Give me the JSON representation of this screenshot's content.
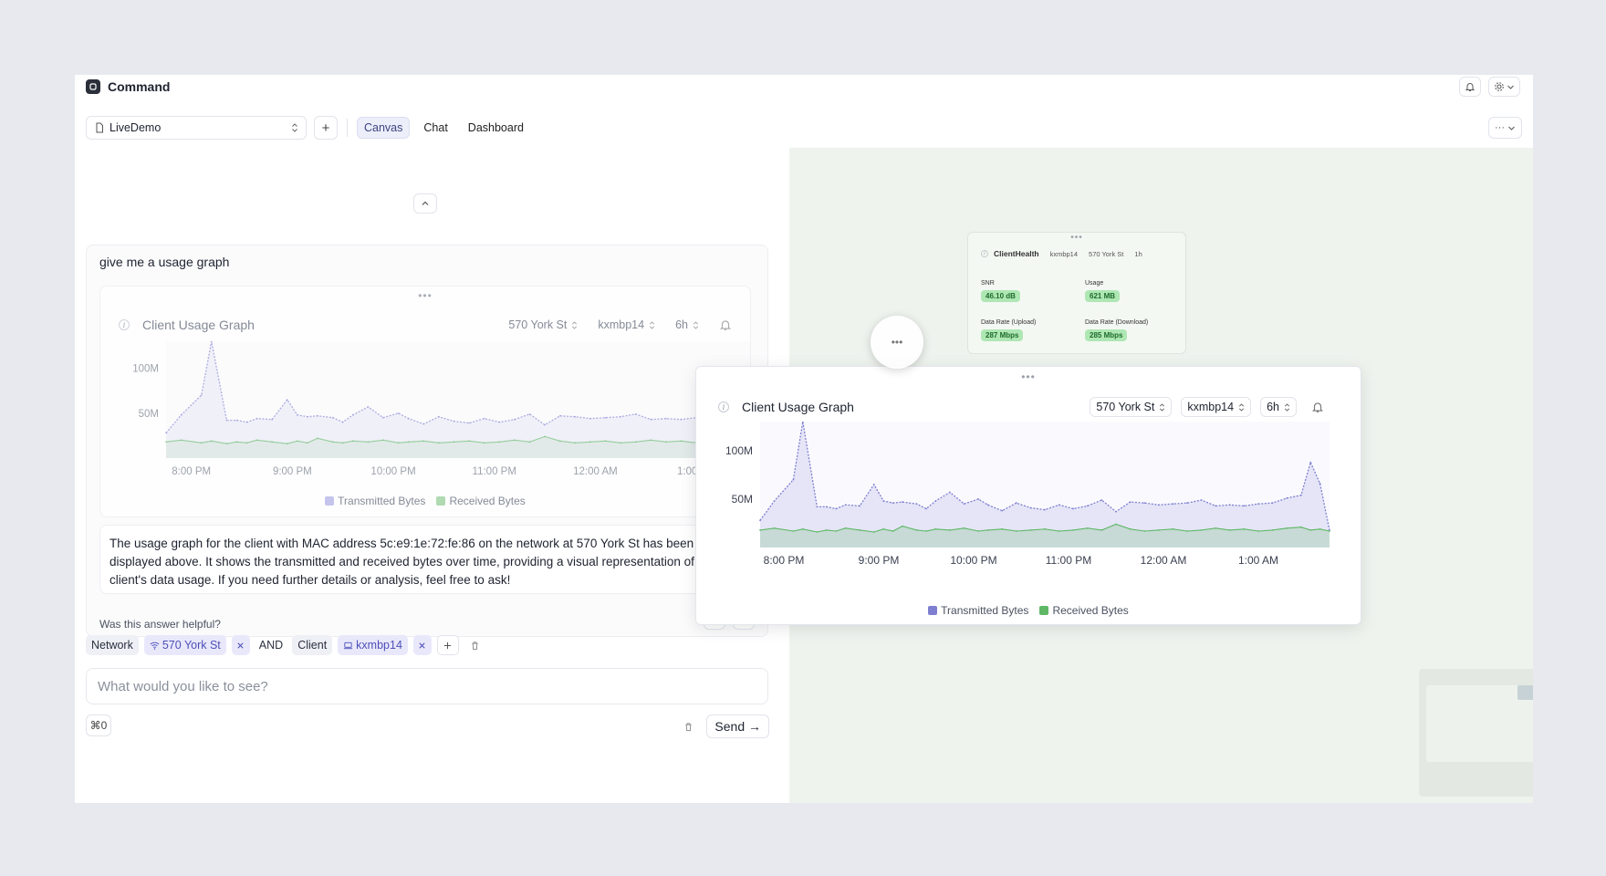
{
  "app": {
    "title": "Command"
  },
  "toolbar": {
    "project": "LiveDemo",
    "tabs": [
      {
        "label": "Canvas",
        "active": true
      },
      {
        "label": "Chat",
        "active": false
      },
      {
        "label": "Dashboard",
        "active": false
      }
    ],
    "more_label": "···"
  },
  "conversation": {
    "prompt": "give me a usage graph",
    "answer": "The usage graph for the client with MAC address 5c:e9:1e:72:fe:86 on the network at 570 York St has been displayed above. It shows the transmitted and received bytes over time, providing a visual representation of the client's data usage. If you need further details or analysis, feel free to ask!",
    "helpful_question": "Was this answer helpful?"
  },
  "usage_chart": {
    "title": "Client Usage Graph",
    "network": "570 York St",
    "client": "kxmbp14",
    "range": "6h",
    "legend": [
      "Transmitted Bytes",
      "Received Bytes"
    ]
  },
  "chart_data": {
    "type": "area",
    "title": "Client Usage Graph",
    "x_ticks": [
      "8:00 PM",
      "9:00 PM",
      "10:00 PM",
      "11:00 PM",
      "12:00 AM",
      "1:00 AM"
    ],
    "y_ticks": [
      "50M",
      "100M"
    ],
    "ylim": [
      0,
      130
    ],
    "x": [
      19.75,
      19.9,
      20.1,
      20.2,
      20.35,
      20.45,
      20.55,
      20.65,
      20.8,
      20.95,
      21.05,
      21.15,
      21.25,
      21.4,
      21.5,
      21.6,
      21.75,
      21.9,
      22.05,
      22.15,
      22.3,
      22.45,
      22.6,
      22.75,
      22.9,
      23.05,
      23.2,
      23.35,
      23.5,
      23.65,
      23.8,
      23.95,
      24.1,
      24.25,
      24.4,
      24.55,
      24.7,
      24.85,
      25.0,
      25.15,
      25.3,
      25.45,
      25.55,
      25.65,
      25.75
    ],
    "series": [
      {
        "name": "Transmitted Bytes",
        "color": "#7f7fd1",
        "values": [
          28,
          48,
          70,
          130,
          42,
          42,
          40,
          44,
          43,
          65,
          48,
          46,
          47,
          45,
          40,
          48,
          57,
          45,
          50,
          44,
          38,
          46,
          41,
          39,
          44,
          40,
          43,
          49,
          37,
          47,
          46,
          44,
          45,
          46,
          49,
          43,
          44,
          43,
          45,
          46,
          51,
          54,
          88,
          66,
          18
        ]
      },
      {
        "name": "Received Bytes",
        "color": "#5fb865",
        "values": [
          18,
          20,
          17,
          19,
          16,
          18,
          17,
          20,
          18,
          16,
          19,
          17,
          22,
          18,
          17,
          19,
          18,
          20,
          17,
          18,
          19,
          17,
          18,
          19,
          17,
          18,
          20,
          18,
          24,
          19,
          17,
          18,
          19,
          17,
          18,
          20,
          18,
          19,
          17,
          18,
          20,
          21,
          18,
          19,
          17
        ]
      }
    ]
  },
  "filters": {
    "network_label": "Network",
    "network_value": "570 York St",
    "and_label": "AND",
    "client_label": "Client",
    "client_value": "kxmbp14"
  },
  "composer": {
    "placeholder": "What would you like to see?",
    "shortcut": "⌘0",
    "send_label": "Send →"
  },
  "client_health": {
    "title": "ClientHealth",
    "client": "kxmbp14",
    "network": "570 York St",
    "range": "1h",
    "metrics": [
      {
        "label": "SNR",
        "value": "46.10 dB"
      },
      {
        "label": "Usage",
        "value": "621 MB"
      },
      {
        "label": "Data Rate (Upload)",
        "value": "287 Mbps"
      },
      {
        "label": "Data Rate (Download)",
        "value": "285 Mbps"
      }
    ]
  },
  "colors": {
    "accent": "#4d4fb8",
    "canvas_bg": "#eef3ee",
    "metric_bg": "#aee7b4"
  }
}
